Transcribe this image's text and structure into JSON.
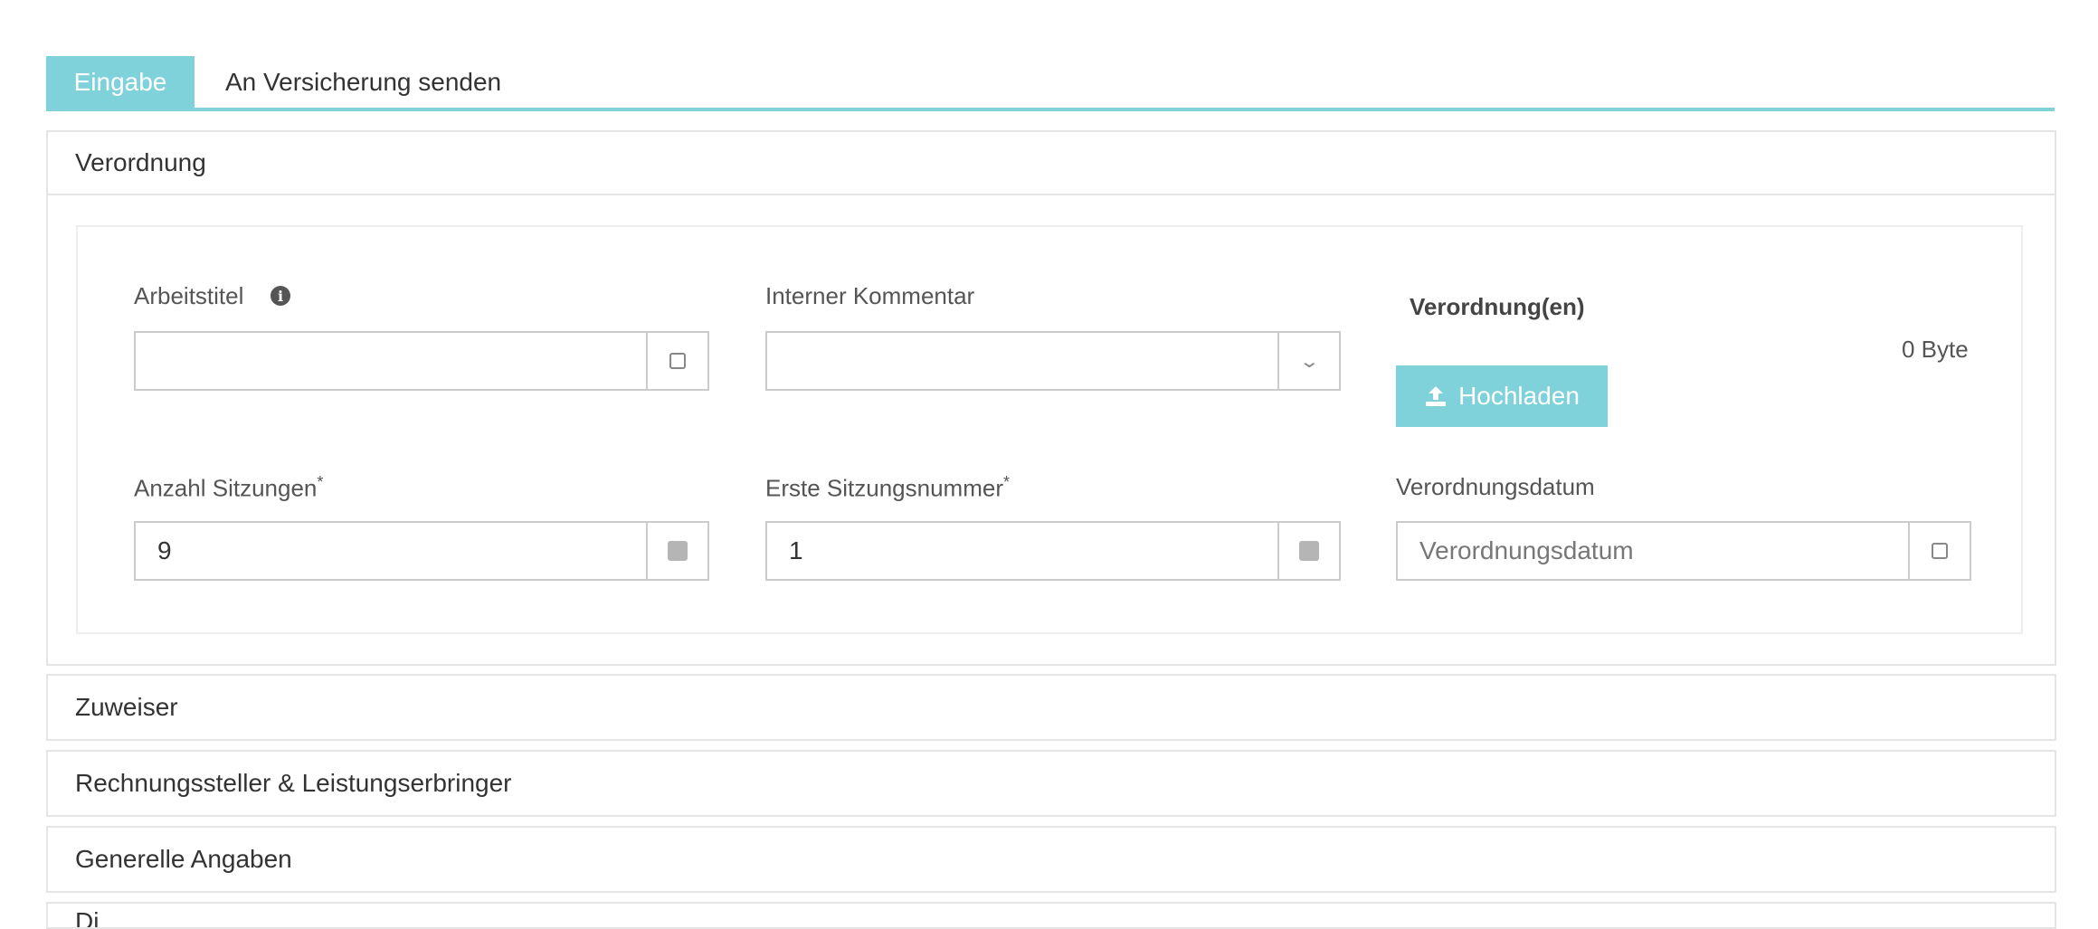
{
  "tabs": {
    "active": "Eingabe",
    "second": "An Versicherung senden"
  },
  "sections": {
    "verordnung": {
      "title": "Verordnung",
      "arbeitstitel": {
        "label": "Arbeitstitel",
        "value": ""
      },
      "kommentar": {
        "label": "Interner Kommentar",
        "value": ""
      },
      "upload": {
        "title": "Verordnung(en)",
        "size": "0 Byte",
        "button": "Hochladen"
      },
      "sitzungen": {
        "label": "Anzahl Sitzungen",
        "required": "*",
        "value": "9"
      },
      "erste": {
        "label": "Erste Sitzungsnummer",
        "required": "*",
        "value": "1"
      },
      "datum": {
        "label": "Verordnungsdatum",
        "placeholder": "Verordnungsdatum",
        "value": ""
      }
    },
    "zuweiser": {
      "title": "Zuweiser"
    },
    "rechnung": {
      "title": "Rechnungssteller & Leistungserbringer"
    },
    "generelle": {
      "title": "Generelle Angaben"
    },
    "next": {
      "title": "Di..."
    }
  },
  "icons": {
    "info": "info-icon",
    "checkbox": "checkbox-icon",
    "chevron": "chevron-down-icon",
    "stepper": "stepper-icon",
    "upload": "upload-icon"
  },
  "colors": {
    "accent": "#7fd1da",
    "border": "#cccccc"
  }
}
